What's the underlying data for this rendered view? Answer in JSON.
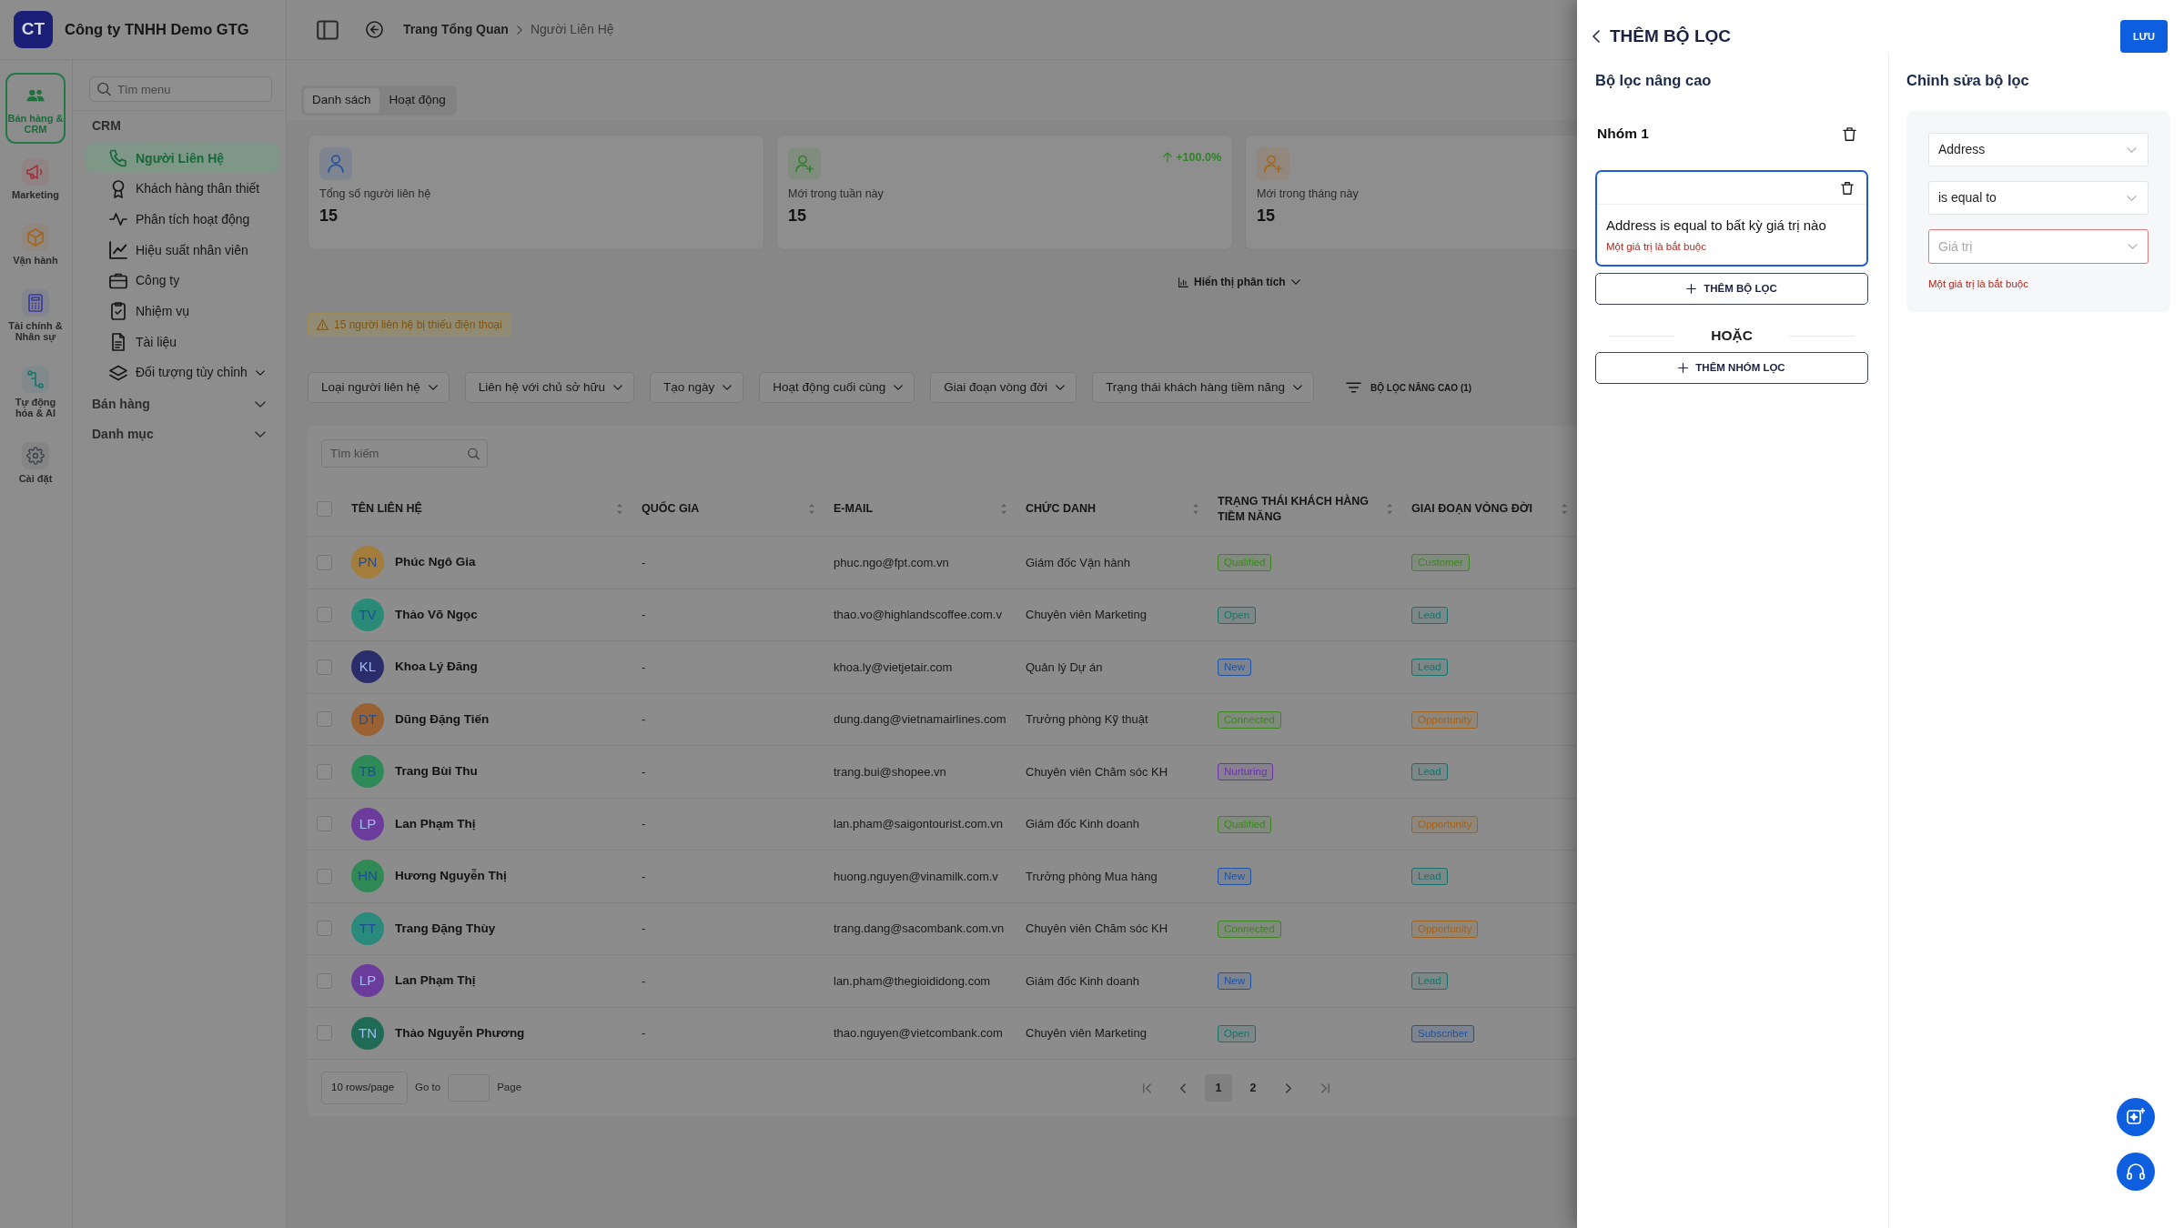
{
  "company": {
    "logo": "CT",
    "name": "Công ty TNHH Demo GTG"
  },
  "modules": [
    {
      "label": "Bán hàng & CRM",
      "selected": true,
      "color": "#1f6f3f"
    },
    {
      "label": "Marketing",
      "selected": false,
      "color": "#a3343f"
    },
    {
      "label": "Vận hành",
      "selected": false,
      "color": "#a5651c"
    },
    {
      "label": "Tài chính & Nhân sự",
      "selected": false,
      "color": "#3a3c9a"
    },
    {
      "label": "Tự động hóa & AI",
      "selected": false,
      "color": "#1d7472"
    },
    {
      "label": "Cài đặt",
      "selected": false,
      "color": "#3d424c"
    }
  ],
  "menu": {
    "search": {
      "placeholder": "Tìm menu"
    },
    "sections": [
      {
        "title": "CRM",
        "expanded": true,
        "items": [
          {
            "label": "Người Liên Hệ",
            "selected": true,
            "kind": "link"
          },
          {
            "label": "Khách hàng thân thiết",
            "selected": false,
            "kind": "link"
          },
          {
            "label": "Phân tích hoạt động",
            "selected": false,
            "kind": "link"
          },
          {
            "label": "Hiệu suất nhân viên",
            "selected": false,
            "kind": "link"
          },
          {
            "label": "Công ty",
            "selected": false,
            "kind": "link"
          },
          {
            "label": "Nhiệm vụ",
            "selected": false,
            "kind": "link"
          },
          {
            "label": "Tài liệu",
            "selected": false,
            "kind": "link"
          },
          {
            "label": "Đối tượng tùy chỉnh",
            "selected": false,
            "kind": "group"
          }
        ]
      },
      {
        "title": "Bán hàng",
        "expanded": false
      },
      {
        "title": "Danh mục",
        "expanded": false
      }
    ]
  },
  "breadcrumb": [
    {
      "label": "Trang Tổng Quan",
      "current": false
    },
    {
      "label": "Người Liên Hệ",
      "current": true
    }
  ],
  "view_tabs": [
    {
      "label": "Danh sách",
      "selected": true
    },
    {
      "label": "Hoạt động",
      "selected": false
    }
  ],
  "stats": [
    {
      "kind": "total",
      "label": "Tổng số người liên hệ",
      "value": "15",
      "color": "#2a54a0"
    },
    {
      "kind": "new",
      "label": "Mới trong tuần này",
      "value": "15",
      "change": "+100.0%",
      "color": "#2e8427"
    },
    {
      "kind": "new",
      "label": "Mới trong tháng này",
      "value": "15",
      "color": "#a8661a"
    }
  ],
  "analytics_toggle": "Hiển thị phân tích",
  "warning": "15 người liên hệ bị thiếu điện thoại",
  "filters": [
    "Loại người liên hệ",
    "Liên hệ với chủ sở hữu",
    "Tạo ngày",
    "Hoạt động cuối cùng",
    "Giai đoạn vòng đời",
    "Trạng thái khách hàng tiềm năng"
  ],
  "advanced_filter": "BỘ LỌC NÂNG CAO (1)",
  "table": {
    "search": {
      "placeholder": "Tìm kiếm"
    },
    "select_all": false,
    "columns": [
      "TÊN LIÊN HỆ",
      "QUỐC GIA",
      "E-MAIL",
      "CHỨC DANH",
      "TRẠNG THÁI KHÁCH HÀNG TIỀM NĂNG",
      "GIAI ĐOẠN VÒNG ĐỜI"
    ],
    "rows": [
      {
        "selected": false,
        "avatar": {
          "initials": "PN",
          "color": "#a27d3c"
        },
        "name": "Phúc Ngô Gia",
        "country": "-",
        "email": "phuc.ngo@fpt.com.vn",
        "title": "Giám đốc Vận hành",
        "status": {
          "text": "Qualified",
          "color": "#3c8620"
        },
        "lifecycle": {
          "text": "Customer",
          "color": "#3c8620"
        }
      },
      {
        "selected": false,
        "avatar": {
          "initials": "TV",
          "color": "#2a8a78"
        },
        "name": "Thảo Võ Ngọc",
        "country": "-",
        "email": "thao.vo@highlandscoffee.com.v",
        "title": "Chuyên viên Marketing",
        "status": {
          "text": "Open",
          "color": "#16736b"
        },
        "lifecycle": {
          "text": "Lead",
          "color": "#16736b"
        }
      },
      {
        "selected": false,
        "avatar": {
          "initials": "KL",
          "color": "#2b2d6b"
        },
        "name": "Khoa Lý Đăng",
        "country": "-",
        "email": "khoa.ly@vietjetair.com",
        "title": "Quản lý Dự án",
        "status": {
          "text": "New",
          "color": "#1f52a3"
        },
        "lifecycle": {
          "text": "Lead",
          "color": "#16736b"
        }
      },
      {
        "selected": false,
        "avatar": {
          "initials": "DT",
          "color": "#9a6232"
        },
        "name": "Dũng Đặng Tiến",
        "country": "-",
        "email": "dung.dang@vietnamairlines.com",
        "title": "Trưởng phòng Kỹ thuật",
        "status": {
          "text": "Connected",
          "color": "#3c8620"
        },
        "lifecycle": {
          "text": "Opportunity",
          "color": "#a3621a"
        }
      },
      {
        "selected": false,
        "avatar": {
          "initials": "TB",
          "color": "#2f8a5a"
        },
        "name": "Trang Bùi Thu",
        "country": "-",
        "email": "trang.bui@shopee.vn",
        "title": "Chuyên viên Chăm sóc KH",
        "status": {
          "text": "Nurturing",
          "color": "#6a33a3"
        },
        "lifecycle": {
          "text": "Lead",
          "color": "#16736b"
        }
      },
      {
        "selected": false,
        "avatar": {
          "initials": "LP",
          "color": "#6c3c9c"
        },
        "name": "Lan Phạm Thị",
        "country": "-",
        "email": "lan.pham@saigontourist.com.vn",
        "title": "Giám đốc Kinh doanh",
        "status": {
          "text": "Qualified",
          "color": "#3c8620"
        },
        "lifecycle": {
          "text": "Opportunity",
          "color": "#a3621a"
        }
      },
      {
        "selected": false,
        "avatar": {
          "initials": "HN",
          "color": "#2f8a55"
        },
        "name": "Hương Nguyễn Thị",
        "country": "-",
        "email": "huong.nguyen@vinamilk.com.v",
        "title": "Trưởng phòng Mua hàng",
        "status": {
          "text": "New",
          "color": "#1f52a3"
        },
        "lifecycle": {
          "text": "Lead",
          "color": "#16736b"
        }
      },
      {
        "selected": false,
        "avatar": {
          "initials": "TT",
          "color": "#2a8a7c"
        },
        "name": "Trang Đặng Thùy",
        "country": "-",
        "email": "trang.dang@sacombank.com.vn",
        "title": "Chuyên viên Chăm sóc KH",
        "status": {
          "text": "Connected",
          "color": "#3c8620"
        },
        "lifecycle": {
          "text": "Opportunity",
          "color": "#a3621a"
        }
      },
      {
        "selected": false,
        "avatar": {
          "initials": "LP",
          "color": "#6c3c9c"
        },
        "name": "Lan Phạm Thị",
        "country": "-",
        "email": "lan.pham@thegioididong.com",
        "title": "Giám đốc Kinh doanh",
        "status": {
          "text": "New",
          "color": "#1f52a3"
        },
        "lifecycle": {
          "text": "Lead",
          "color": "#16736b"
        }
      },
      {
        "selected": false,
        "avatar": {
          "initials": "TN",
          "color": "#1f6b55"
        },
        "name": "Thảo Nguyễn Phương",
        "country": "-",
        "email": "thao.nguyen@vietcombank.com",
        "title": "Chuyên viên Marketing",
        "status": {
          "text": "Open",
          "color": "#16736b"
        },
        "lifecycle": {
          "text": "Subscriber",
          "color": "#1f52a3"
        }
      }
    ]
  },
  "pagination": {
    "page_size": "10 rows/page",
    "goto_label": "Go to",
    "page_label": "Page",
    "pages": [
      {
        "label": "1",
        "selected": true
      },
      {
        "label": "2",
        "selected": false
      }
    ]
  },
  "drawer": {
    "title": "THÊM BỘ LỌC",
    "save_label": "LƯU",
    "builder": {
      "heading": "Bộ lọc nâng cao",
      "groups": [
        {
          "title": "Nhóm 1",
          "conditions": [
            {
              "summary": "Address is equal to bất kỳ giá trị nào",
              "error": "Một giá trị là bắt buộc",
              "selected": true
            }
          ],
          "add_filter_label": "THÊM BỘ LỌC"
        }
      ],
      "or_label": "HOẶC",
      "add_group_label": "THÊM NHÓM LỌC"
    },
    "editor": {
      "heading": "Chỉnh sửa bộ lọc",
      "fields": [
        {
          "value": "Address",
          "invalid": false
        },
        {
          "value": "is equal to",
          "invalid": false
        },
        {
          "placeholder": "Giá trị",
          "invalid": true
        }
      ],
      "error": "Một giá trị là bắt buộc"
    }
  }
}
